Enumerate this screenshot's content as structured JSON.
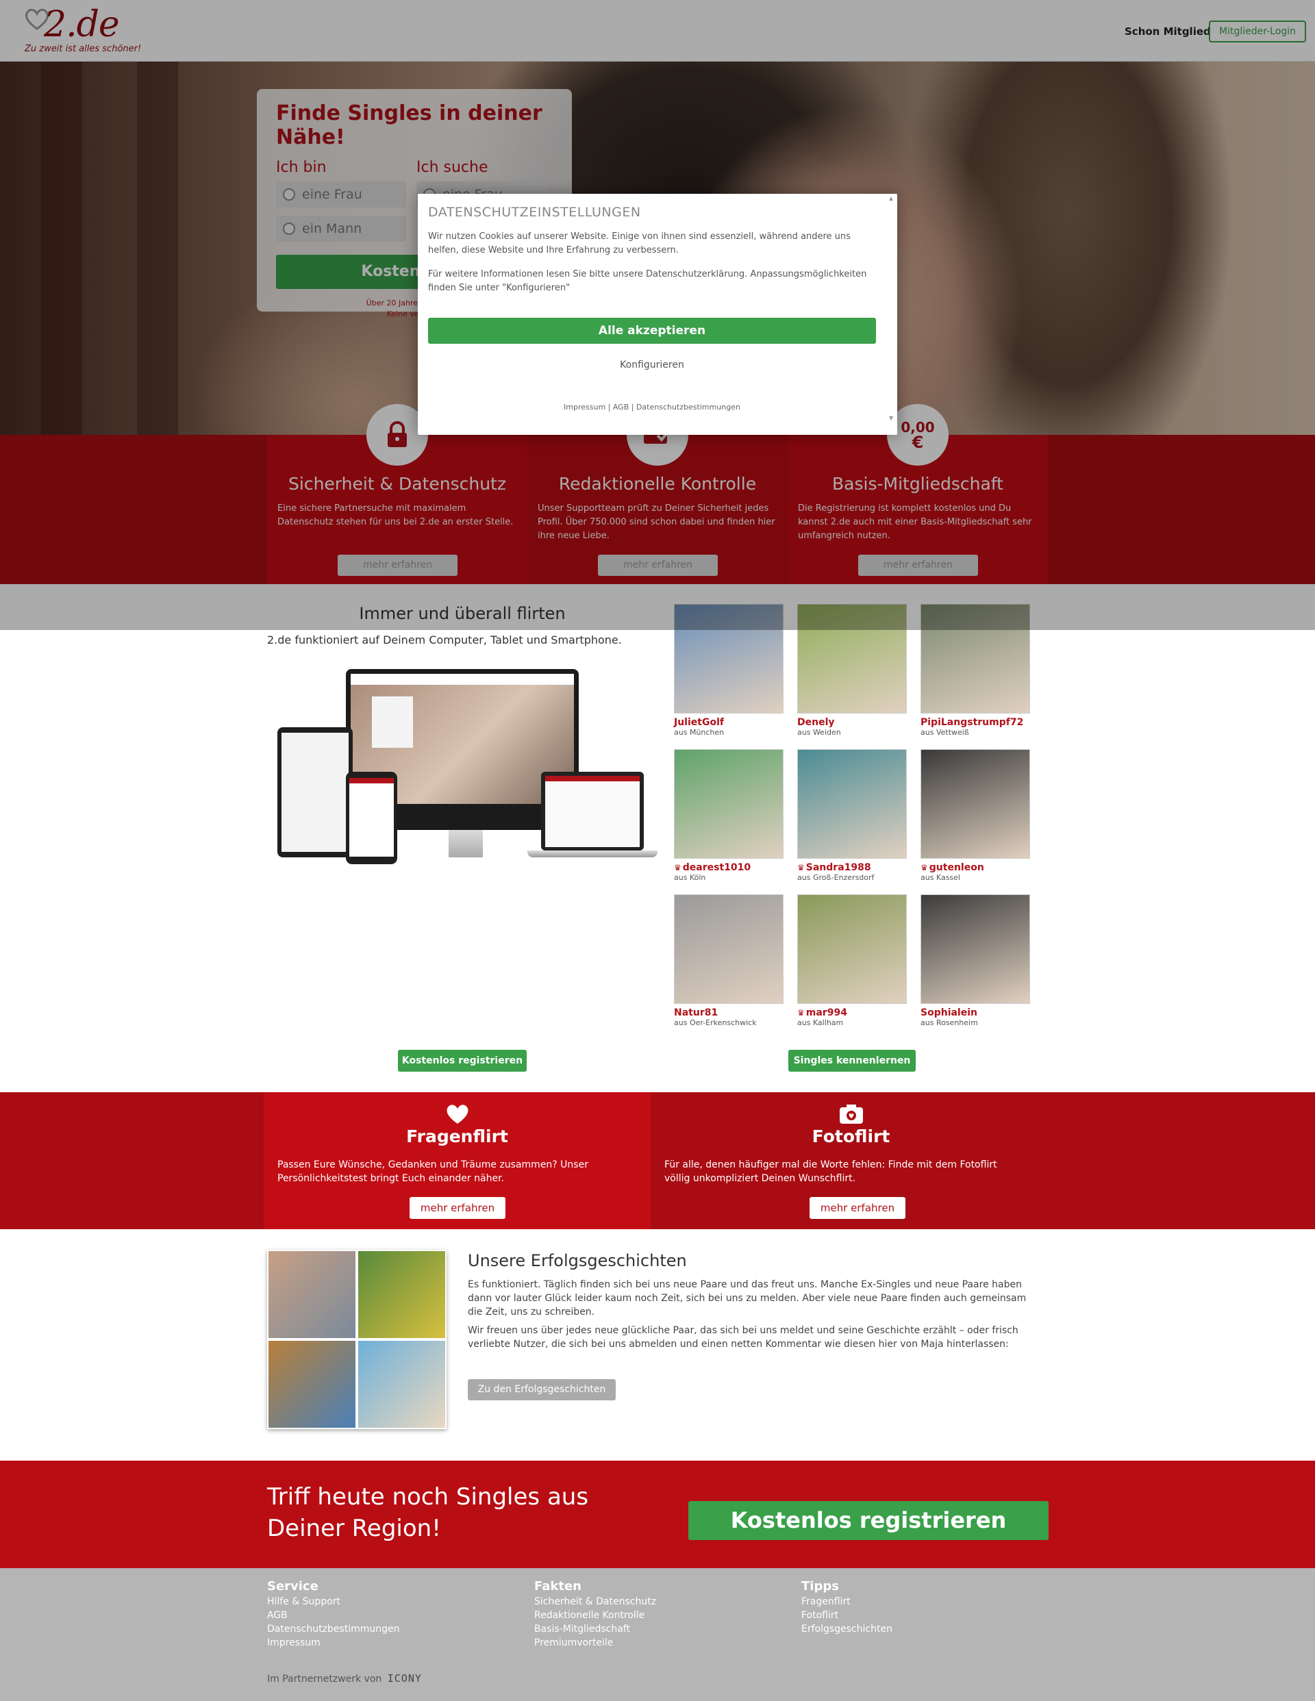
{
  "header": {
    "logo_text": "2.de",
    "logo_tagline": "Zu zweit ist alles schöner!",
    "member_question": "Schon Mitglied?",
    "login_label": "Mitglieder-Login"
  },
  "search": {
    "title": "Finde Singles in deiner Nähe!",
    "iam_label": "Ich bin",
    "seek_label": "Ich suche",
    "iam_options": [
      "eine Frau",
      "ein Mann"
    ],
    "seek_options": [
      "eine Frau"
    ],
    "register_label": "Kostenlos re",
    "note_line1": "Über 20 Jahre Erfahrung |",
    "note_line2": "Keine versteck"
  },
  "cookie": {
    "title": "DATENSCHUTZEINSTELLUNGEN",
    "p1": "Wir nutzen Cookies auf unserer Website. Einige von ihnen sind essenziell, während andere uns helfen, diese Website und Ihre Erfahrung zu verbessern.",
    "p2": "Für weitere Informationen lesen Sie bitte unsere Datenschutzerklärung. Anpassungsmöglichkeiten finden Sie unter \"Konfigurieren\"",
    "accept_label": "Alle akzeptieren",
    "configure_label": "Konfigurieren",
    "footer_links": "Impressum | AGB | Datenschutzbestimmungen"
  },
  "features": [
    {
      "icon": "lock-icon",
      "title": "Sicherheit & Datenschutz",
      "text": "Eine sichere Partnersuche mit maximalem Datenschutz stehen für uns bei 2.de an erster Stelle.",
      "button": "mehr erfahren"
    },
    {
      "icon": "profile-check-icon",
      "title": "Redaktionelle Kontrolle",
      "text": "Unser Supportteam prüft zu Deiner Sicherheit jedes Profil. Über 750.000 sind schon dabei und finden hier ihre neue Liebe.",
      "button": "mehr erfahren"
    },
    {
      "icon": "price-badge",
      "badge_line1": "0,00",
      "badge_line2": "€",
      "title": "Basis-Mitgliedschaft",
      "text": "Die Registrierung ist komplett kostenlos und Du kannst 2.de auch mit einer Basis-Mitgliedschaft sehr umfangreich nutzen.",
      "button": "mehr erfahren"
    }
  ],
  "flirt": {
    "title": "Immer und überall flirten",
    "subtitle": "2.de funktioniert auf Deinem Computer, Tablet und Smartphone.",
    "register_label": "Kostenlos registrieren",
    "singles_label": "Singles kennenlernen"
  },
  "profiles": [
    {
      "name": "JulietGolf",
      "location": "aus München",
      "premium": false,
      "color": "#6b8fb8"
    },
    {
      "name": "Denely",
      "location": "aus Weiden",
      "premium": false,
      "color": "#8fae5a"
    },
    {
      "name": "PipiLangstrumpf72",
      "location": "aus Vettweiß",
      "premium": false,
      "color": "#7d8a72"
    },
    {
      "name": "dearest1010",
      "location": "aus Köln",
      "premium": true,
      "color": "#5fa36b"
    },
    {
      "name": "Sandra1988",
      "location": "aus Groß-Enzersdorf",
      "premium": true,
      "color": "#4b8c95"
    },
    {
      "name": "gutenleon",
      "location": "aus Kassel",
      "premium": true,
      "color": "#3a3a3a"
    },
    {
      "name": "Natur81",
      "location": "aus Oer-Erkenschwick",
      "premium": false,
      "color": "#9a9a9a"
    },
    {
      "name": "mar994",
      "location": "aus Kallham",
      "premium": true,
      "color": "#8a9a5a"
    },
    {
      "name": "Sophialein",
      "location": "aus Rosenheim",
      "premium": false,
      "color": "#3c3c3c"
    }
  ],
  "tiles": [
    {
      "icon": "heart-icon",
      "title": "Fragenflirt",
      "text": "Passen Eure Wünsche, Gedanken und Träume zusammen? Unser Persönlichkeitstest bringt Euch einander näher.",
      "button": "mehr erfahren"
    },
    {
      "icon": "camera-icon",
      "title": "Fotoflirt",
      "text": "Für alle, denen häufiger mal die Worte fehlen: Finde mit dem Fotoflirt völlig unkompliziert Deinen Wunschflirt.",
      "button": "mehr erfahren"
    }
  ],
  "success": {
    "title": "Unsere Erfolgsgeschichten",
    "p1": "Es funktioniert. Täglich finden sich bei uns neue Paare und das freut uns. Manche Ex-Singles und neue Paare haben dann vor lauter Glück leider kaum noch Zeit, sich bei uns zu melden. Aber viele neue Paare finden auch gemeinsam die Zeit, uns zu schreiben.",
    "p2": "Wir freuen uns über jedes neue glückliche Paar, das sich bei uns meldet und seine Geschichte erzählt – oder frisch verliebte Nutzer, die sich bei uns abmelden und einen netten Kommentar wie diesen hier von Maja hinterlassen:",
    "button": "Zu den Erfolgsgeschichten"
  },
  "cta": {
    "text": "Triff heute noch Singles aus Deiner Region!",
    "button": "Kostenlos registrieren"
  },
  "footer": {
    "columns": [
      {
        "title": "Service",
        "links": [
          "Hilfe & Support",
          "AGB",
          "Datenschutzbestimmungen",
          "Impressum"
        ]
      },
      {
        "title": "Fakten",
        "links": [
          "Sicherheit & Datenschutz",
          "Redaktionelle Kontrolle",
          "Basis-Mitgliedschaft",
          "Premiumvorteile"
        ]
      },
      {
        "title": "Tipps",
        "links": [
          "Fragenflirt",
          "Fotoflirt",
          "Erfolgsgeschichten"
        ]
      }
    ],
    "partner_text": "Im Partnernetzwerk von",
    "partner_logo": "ICONY"
  },
  "colors": {
    "brand_red": "#b0131a",
    "green": "#3aa04a"
  }
}
